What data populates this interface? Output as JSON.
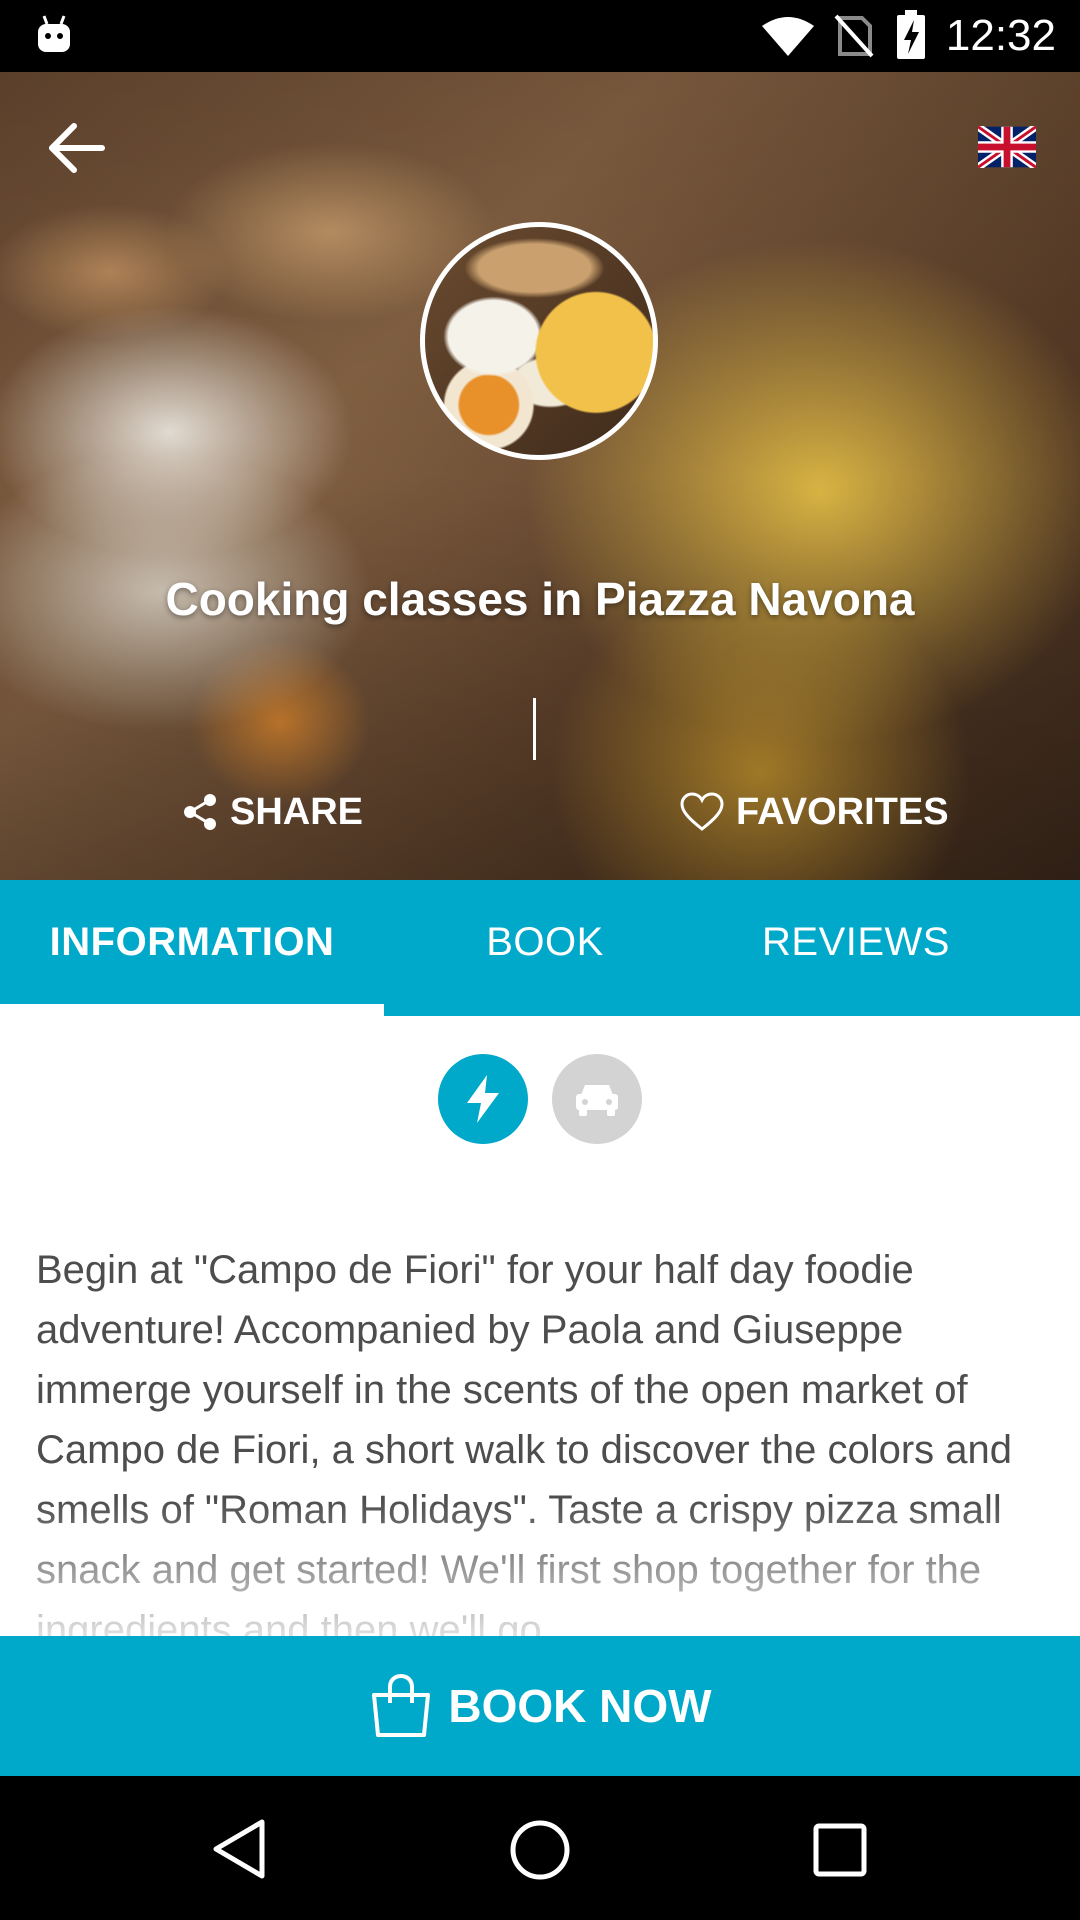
{
  "status_bar": {
    "time": "12:32",
    "icons": [
      "android-icon",
      "wifi-icon",
      "no-sim-icon",
      "battery-charging-icon"
    ]
  },
  "hero": {
    "title": "Cooking classes in Piazza Navona",
    "back_icon": "arrow-left-icon",
    "language_icon": "uk-flag-icon",
    "share_label": "SHARE",
    "favorites_label": "FAVORITES"
  },
  "tabs": [
    {
      "label": "INFORMATION",
      "active": true
    },
    {
      "label": "BOOK",
      "active": false
    },
    {
      "label": "REVIEWS",
      "active": false
    }
  ],
  "categories": [
    {
      "icon": "lightning-icon",
      "active": true
    },
    {
      "icon": "car-icon",
      "active": false
    }
  ],
  "description": "Begin at \"Campo de Fiori\" for your half day foodie adventure! Accompanied by Paola and Giuseppe immerge yourself in the scents of the open market of Campo de Fiori, a short walk to discover the colors and smells of \"Roman Holidays\". Taste a crispy pizza small snack and get started! We'll first shop together for the ingredients and then we'll go",
  "book_now": {
    "label": "BOOK NOW",
    "icon": "shopping-bag-icon"
  },
  "nav_bar": {
    "icons": [
      "nav-back-icon",
      "nav-home-icon",
      "nav-recents-icon"
    ]
  },
  "colors": {
    "accent": "#00a8c9",
    "inactive_icon": "#d3d3d3",
    "text": "#4d4d4d"
  }
}
